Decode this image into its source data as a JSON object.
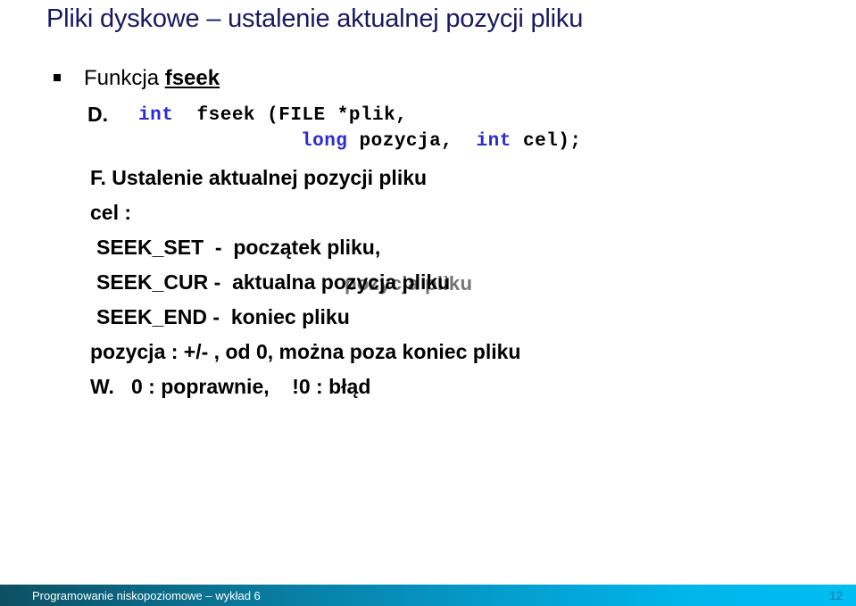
{
  "slide": {
    "title": "Pliki dyskowe – ustalenie aktualnej pozycji pliku",
    "title_color": "#19195e",
    "background_color": "#ffffff"
  },
  "bullet": {
    "marker": "square-bullet",
    "text_prefix": "Funkcja ",
    "keyword": "fseek"
  },
  "code": {
    "label": "D.",
    "line1": {
      "keyword": "int",
      "rest": "  fseek (FILE *plik,"
    },
    "line2": {
      "keyword1": "long",
      "mid": " pozycja,  ",
      "keyword2": "int",
      "rest": " cel);"
    },
    "keyword_color": "#2b2bd4",
    "text_color": "#000000"
  },
  "lines": {
    "f_heading": "F. Ustalenie aktualnej pozycji pliku",
    "cel_label": "cel :",
    "seek_set": "SEEK_SET  -  początek pliku,",
    "seek_cur": "SEEK_CUR -  aktualna pozycja pliku",
    "seek_cur_ghost": "pozycja pliku",
    "seek_end": "SEEK_END -  koniec pliku",
    "pozycja": "pozycja : +/- , od 0, można poza koniec pliku",
    "w_line": "W.   0 : poprawnie,    !0 : błąd"
  },
  "footer": {
    "text": "Programowanie niskopoziomowe – wykład 6",
    "page_number": "12",
    "gradient_start": "#0c4f62",
    "gradient_end": "#00bdf2",
    "text_color": "#ffffff",
    "page_number_color": "#0f7da3"
  }
}
